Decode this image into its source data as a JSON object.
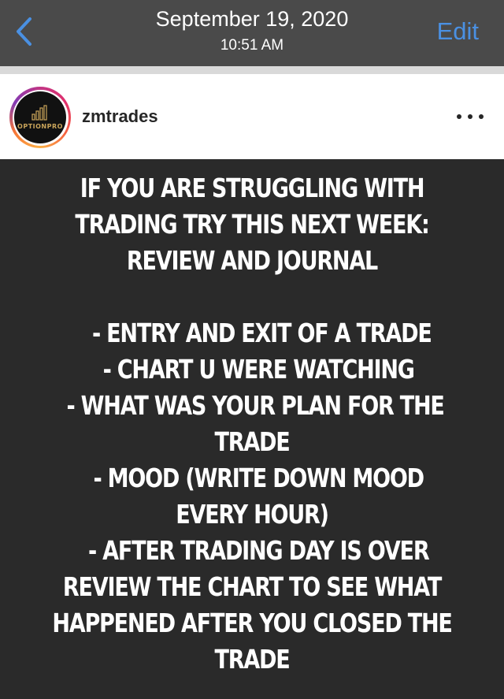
{
  "nav": {
    "title": "September 19, 2020",
    "subtitle": "10:51 AM",
    "edit_label": "Edit",
    "accent_color": "#4a90e2"
  },
  "post": {
    "username": "zmtrades",
    "avatar_brand": "OPTIONPRO",
    "icons": {
      "back": "chevron-left-icon",
      "more": "more-horizontal-icon",
      "avatar_logo": "bar-chart-icon"
    },
    "lines": [
      "IF YOU ARE STRUGGLING WITH",
      "TRADING TRY THIS NEXT WEEK:",
      "REVIEW AND JOURNAL",
      "",
      "   - ENTRY AND EXIT OF A TRADE",
      "  - CHART U WERE WATCHING",
      " - WHAT WAS YOUR PLAN FOR THE",
      "TRADE",
      "  - MOOD (WRITE DOWN MOOD",
      "EVERY HOUR)",
      "  - AFTER TRADING DAY IS OVER",
      "REVIEW THE CHART TO SEE WHAT",
      "HAPPENED AFTER YOU CLOSED THE",
      "TRADE"
    ]
  }
}
